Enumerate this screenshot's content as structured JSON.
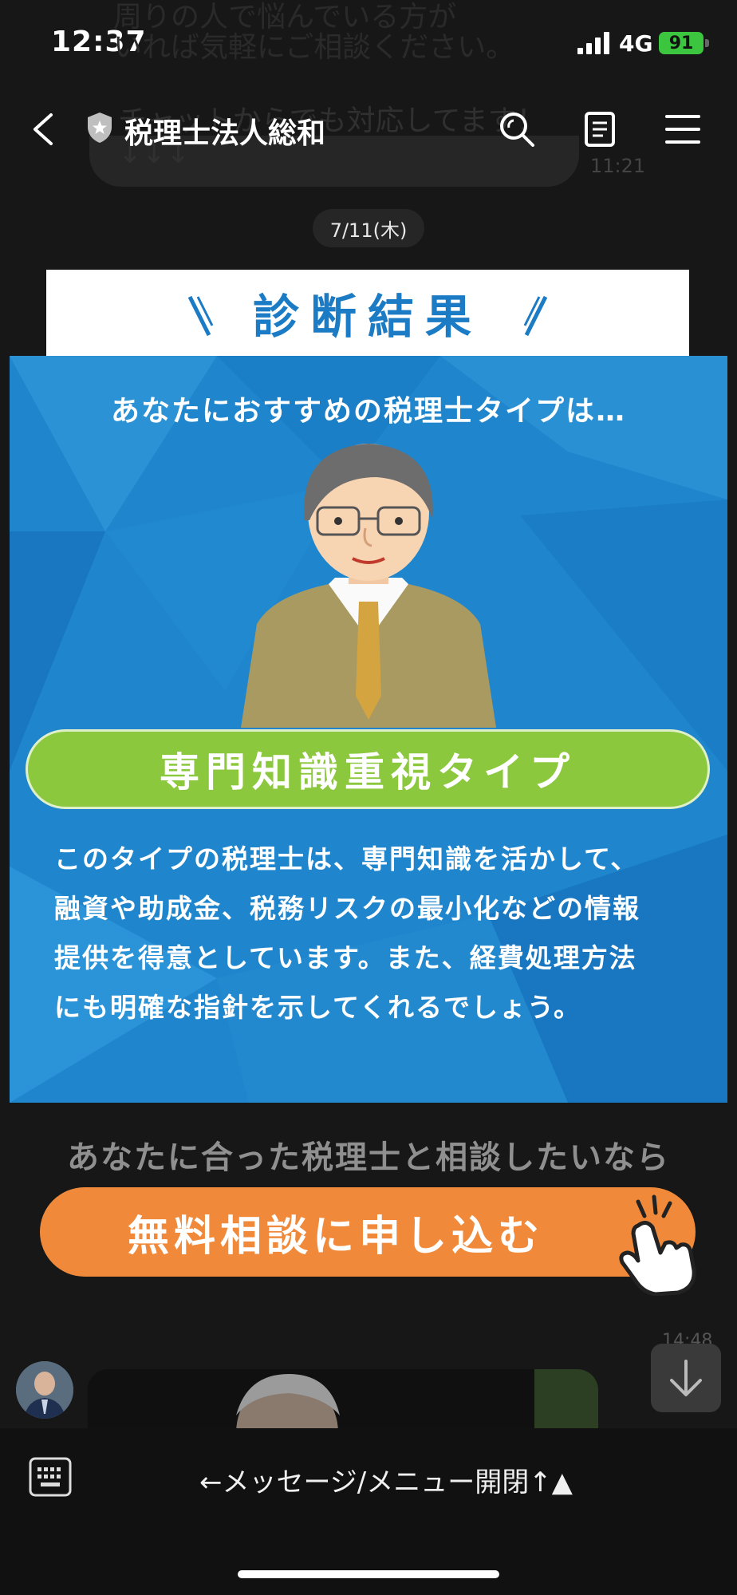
{
  "status": {
    "time": "12:37",
    "network": "4G",
    "battery": "91"
  },
  "behind_header": {
    "line1": "周りの人で悩んでいる方が",
    "line2": "いれば気軽にご相談ください。",
    "line3": "チャットからでも対応してます！",
    "arrows": "↓↓↓",
    "timestamp": "11:21"
  },
  "header": {
    "title": "税理士法人総和"
  },
  "date": "7/11(木)",
  "diagnosis": {
    "title": "診断結果",
    "lead": "あなたにおすすめの税理士タイプは…",
    "type_label": "専門知識重視タイプ",
    "description_lines": [
      "このタイプの税理士は、専門知識を活かして、",
      "融資や助成金、税務リスクの最小化などの情報",
      "提供を得意としています。また、経費処理方法",
      "にも明確な指針を示してくれるでしょう。"
    ]
  },
  "cta": {
    "subtitle": "あなたに合った税理士と相談したいなら",
    "button": "無料相談に申し込む"
  },
  "message2": {
    "timestamp": "14:48"
  },
  "bottom": {
    "menu_toggle": "←メッセージ/メニュー開閉↑▲"
  },
  "colors": {
    "background": "#171717",
    "panel_blue": "#1f86cd",
    "title_blue": "#1b7bc4",
    "type_green": "#8cc83e",
    "cta_orange": "#f08a3a",
    "battery_green": "#3cc53f"
  }
}
